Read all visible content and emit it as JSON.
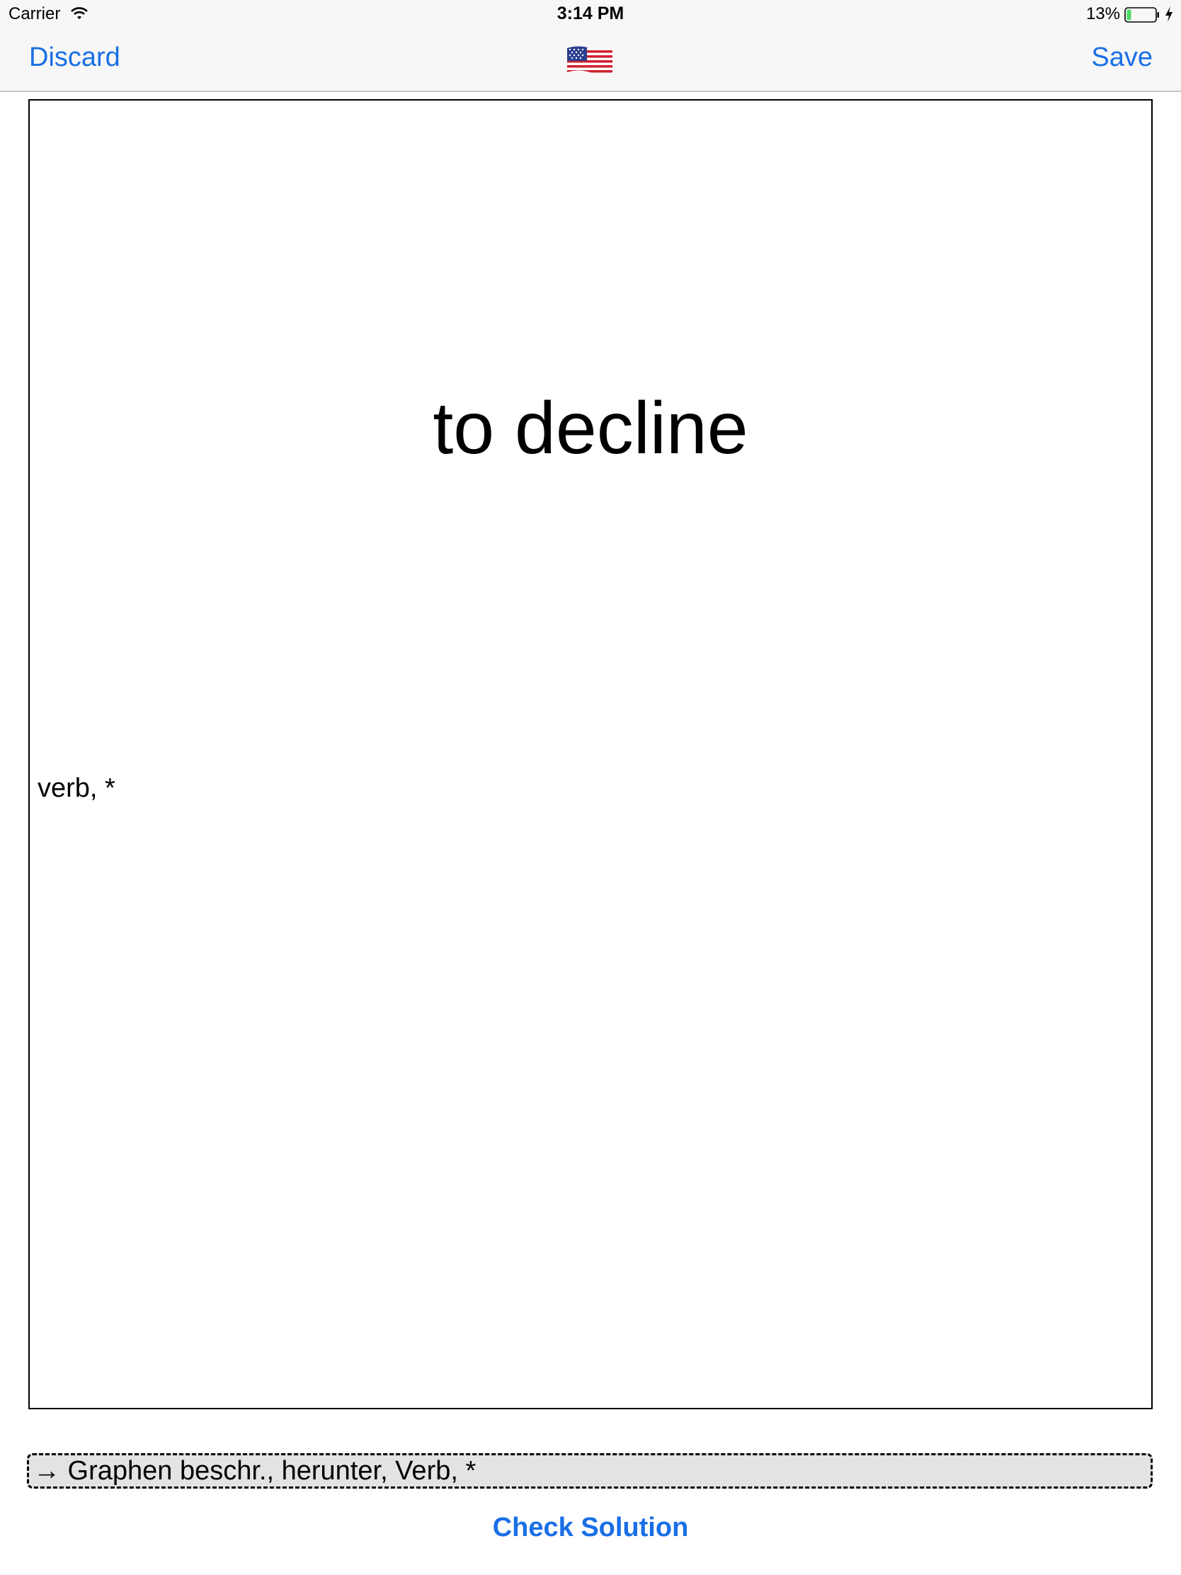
{
  "status_bar": {
    "carrier": "Carrier",
    "time": "3:14 PM",
    "battery_percent": "13%",
    "icons": [
      "wifi-icon",
      "battery-icon",
      "charging-icon"
    ]
  },
  "nav_bar": {
    "discard_label": "Discard",
    "save_label": "Save",
    "center_icon": "us-flag-icon"
  },
  "card": {
    "term": "to decline",
    "meta": "verb, *"
  },
  "answer": {
    "value": "→ Graphen beschr., herunter, Verb, *"
  },
  "actions": {
    "check_label": "Check Solution"
  },
  "colors": {
    "accent": "#1a6fe6",
    "bar_background": "#f7f7f7",
    "field_background": "#e3e3e3",
    "battery_fill": "#4cd964"
  }
}
